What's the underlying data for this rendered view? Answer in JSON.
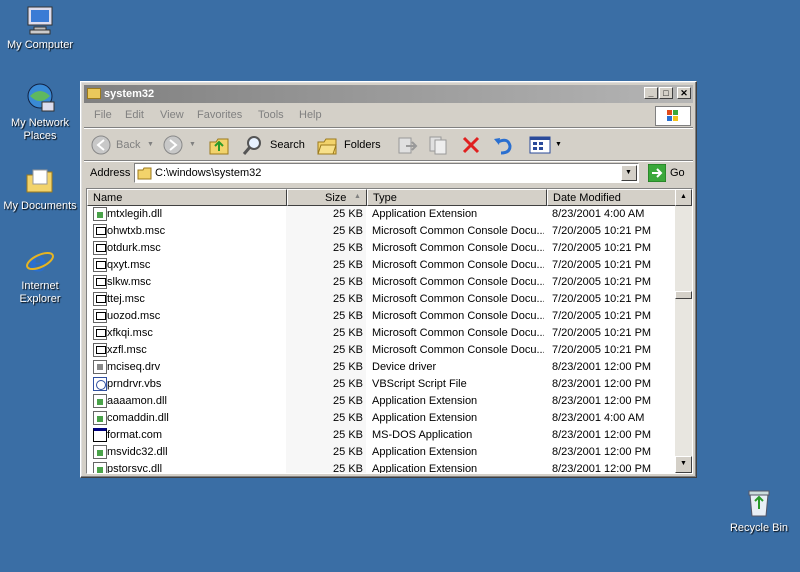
{
  "desktop": {
    "icons": [
      {
        "label": "My Computer",
        "icon": "computer-icon"
      },
      {
        "label": "My Network Places",
        "icon": "network-icon"
      },
      {
        "label": "My Documents",
        "icon": "folder-icon"
      },
      {
        "label": "Internet Explorer",
        "icon": "ie-icon"
      },
      {
        "label": "Recycle Bin",
        "icon": "recycle-bin-icon"
      }
    ]
  },
  "window": {
    "title": "system32",
    "controls": {
      "minimize": "_",
      "maximize": "□",
      "close": "✕"
    },
    "menu": [
      "File",
      "Edit",
      "View",
      "Favorites",
      "Tools",
      "Help"
    ],
    "toolbar": {
      "back": "Back",
      "search": "Search",
      "folders": "Folders"
    },
    "address": {
      "label": "Address",
      "value": "C:\\windows\\system32",
      "go": "Go"
    },
    "columns": {
      "name": "Name",
      "size": "Size",
      "type": "Type",
      "date": "Date Modified"
    },
    "files": [
      {
        "name": "mtxlegih.dll",
        "size": "25 KB",
        "type": "Application Extension",
        "date": "8/23/2001 4:00 AM",
        "kind": "dll"
      },
      {
        "name": "ohwtxb.msc",
        "size": "25 KB",
        "type": "Microsoft Common Console Docu...",
        "date": "7/20/2005 10:21 PM",
        "kind": "msc"
      },
      {
        "name": "otdurk.msc",
        "size": "25 KB",
        "type": "Microsoft Common Console Docu...",
        "date": "7/20/2005 10:21 PM",
        "kind": "msc"
      },
      {
        "name": "qxyt.msc",
        "size": "25 KB",
        "type": "Microsoft Common Console Docu...",
        "date": "7/20/2005 10:21 PM",
        "kind": "msc"
      },
      {
        "name": "slkw.msc",
        "size": "25 KB",
        "type": "Microsoft Common Console Docu...",
        "date": "7/20/2005 10:21 PM",
        "kind": "msc"
      },
      {
        "name": "ttej.msc",
        "size": "25 KB",
        "type": "Microsoft Common Console Docu...",
        "date": "7/20/2005 10:21 PM",
        "kind": "msc"
      },
      {
        "name": "uozod.msc",
        "size": "25 KB",
        "type": "Microsoft Common Console Docu...",
        "date": "7/20/2005 10:21 PM",
        "kind": "msc"
      },
      {
        "name": "xfkqi.msc",
        "size": "25 KB",
        "type": "Microsoft Common Console Docu...",
        "date": "7/20/2005 10:21 PM",
        "kind": "msc"
      },
      {
        "name": "xzfl.msc",
        "size": "25 KB",
        "type": "Microsoft Common Console Docu...",
        "date": "7/20/2005 10:21 PM",
        "kind": "msc"
      },
      {
        "name": "mciseq.drv",
        "size": "25 KB",
        "type": "Device driver",
        "date": "8/23/2001 12:00 PM",
        "kind": "drv"
      },
      {
        "name": "prndrvr.vbs",
        "size": "25 KB",
        "type": "VBScript Script File",
        "date": "8/23/2001 12:00 PM",
        "kind": "vbs"
      },
      {
        "name": "aaaamon.dll",
        "size": "25 KB",
        "type": "Application Extension",
        "date": "8/23/2001 12:00 PM",
        "kind": "dll"
      },
      {
        "name": "comaddin.dll",
        "size": "25 KB",
        "type": "Application Extension",
        "date": "8/23/2001 4:00 AM",
        "kind": "dll"
      },
      {
        "name": "format.com",
        "size": "25 KB",
        "type": "MS-DOS Application",
        "date": "8/23/2001 12:00 PM",
        "kind": "com"
      },
      {
        "name": "msvidc32.dll",
        "size": "25 KB",
        "type": "Application Extension",
        "date": "8/23/2001 12:00 PM",
        "kind": "dll"
      },
      {
        "name": "pstorsvc.dll",
        "size": "25 KB",
        "type": "Application Extension",
        "date": "8/23/2001 12:00 PM",
        "kind": "dll"
      }
    ]
  }
}
